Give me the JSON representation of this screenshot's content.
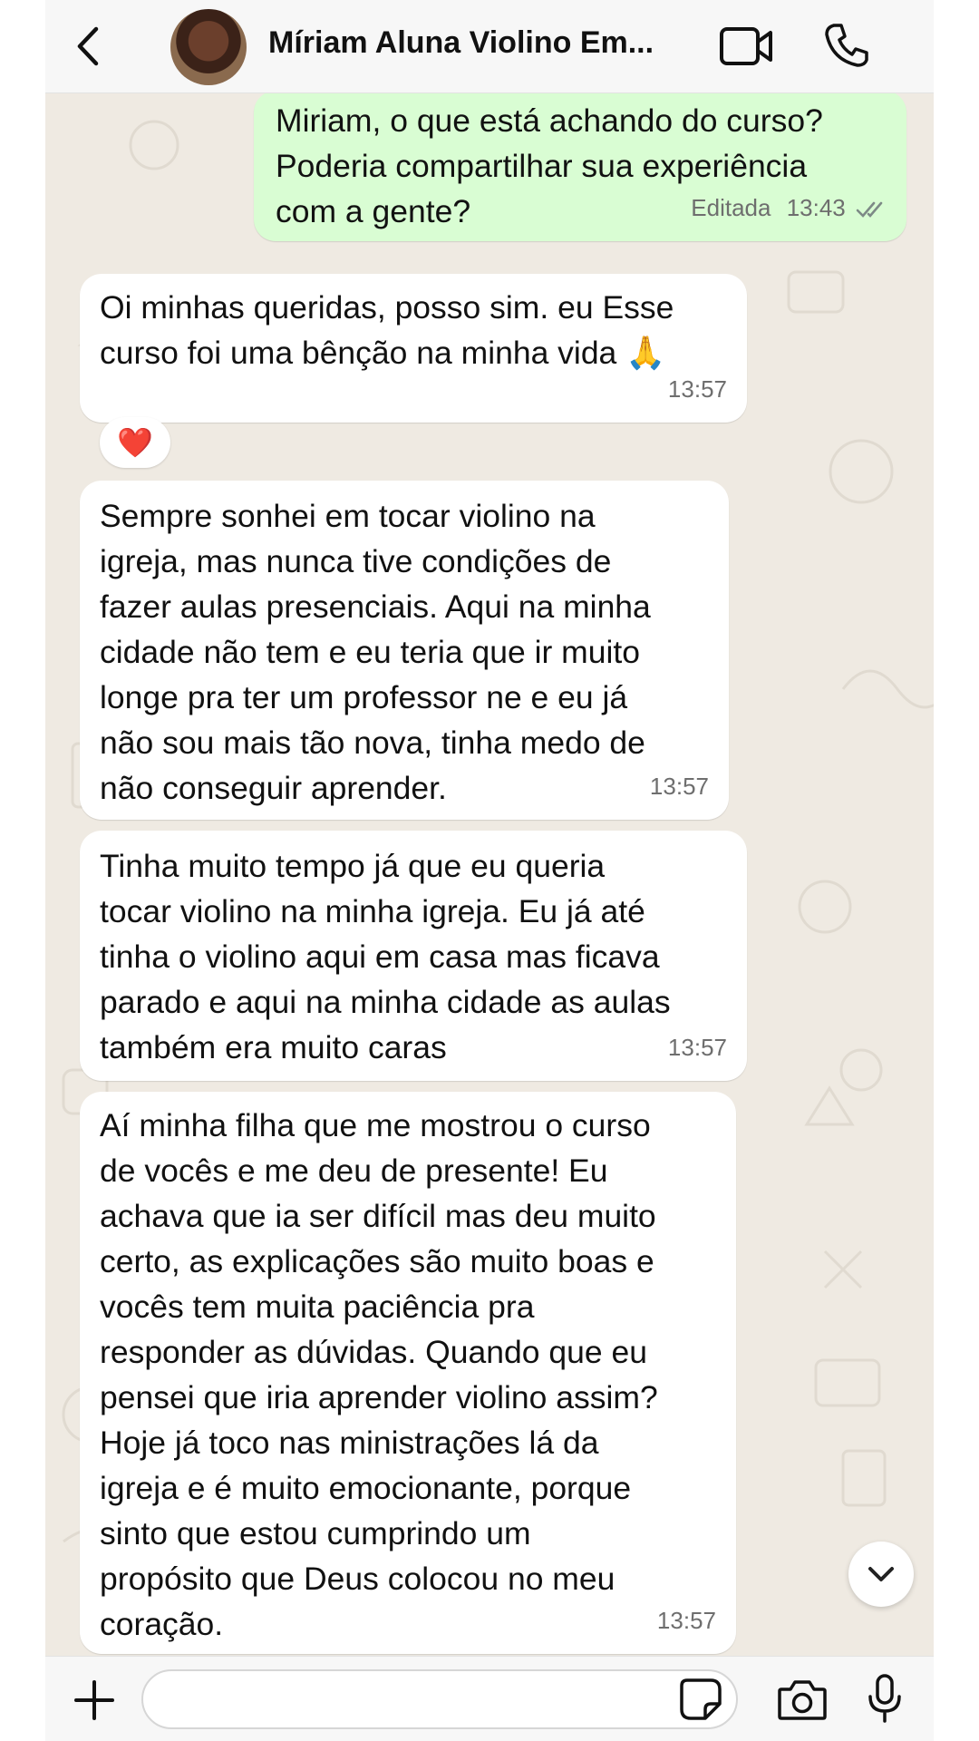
{
  "header": {
    "contact_name": "Míriam Aluna Violino Em...",
    "icons": [
      "chevron-left-icon",
      "avatar",
      "video-camera-icon",
      "phone-icon"
    ]
  },
  "messages": [
    {
      "direction": "out",
      "text": "Miriam, o que está achando do curso?\nPoderia compartilhar sua experiência\ncom a gente?",
      "edited_label": "Editada",
      "time": "13:43",
      "status": "double-check"
    },
    {
      "direction": "in",
      "text": "Oi minhas queridas, posso sim. eu Esse\ncurso foi uma bênção na minha vida 🙏",
      "time": "13:57",
      "reaction": "❤️"
    },
    {
      "direction": "in",
      "text": "Sempre sonhei em tocar violino na\nigreja, mas nunca tive condições de\nfazer aulas presenciais. Aqui na minha\ncidade não tem e eu teria que ir muito\nlonge pra ter um professor ne e eu já\nnão sou mais tão nova, tinha medo de\nnão conseguir aprender.",
      "time": "13:57"
    },
    {
      "direction": "in",
      "text": "Tinha muito tempo já que eu queria\ntocar violino na minha igreja. Eu já até\ntinha o violino aqui em casa mas ficava\nparado e aqui na minha cidade as aulas\ntambém era muito caras",
      "time": "13:57"
    },
    {
      "direction": "in",
      "text": "Aí minha filha que me mostrou o curso\nde vocês e me deu de presente! Eu\nachava que ia ser difícil mas deu muito\ncerto, as explicações são muito boas e\nvocês tem muita paciência pra\nresponder as dúvidas. Quando que eu\npensei que iria aprender violino assim?\nHoje já toco nas ministrações lá da\nigreja e é muito emocionante, porque\nsinto que estou cumprindo um\npropósito que Deus colocou no meu\ncoração.",
      "time": "13:57"
    }
  ],
  "composer": {
    "value": "",
    "icons": [
      "plus-icon",
      "sticker-icon",
      "camera-icon",
      "microphone-icon"
    ]
  },
  "colors": {
    "chat_background": "#efeae2",
    "outgoing_bubble": "#d9fdd3",
    "incoming_bubble": "#ffffff",
    "bar_background": "#f7f7f7"
  }
}
